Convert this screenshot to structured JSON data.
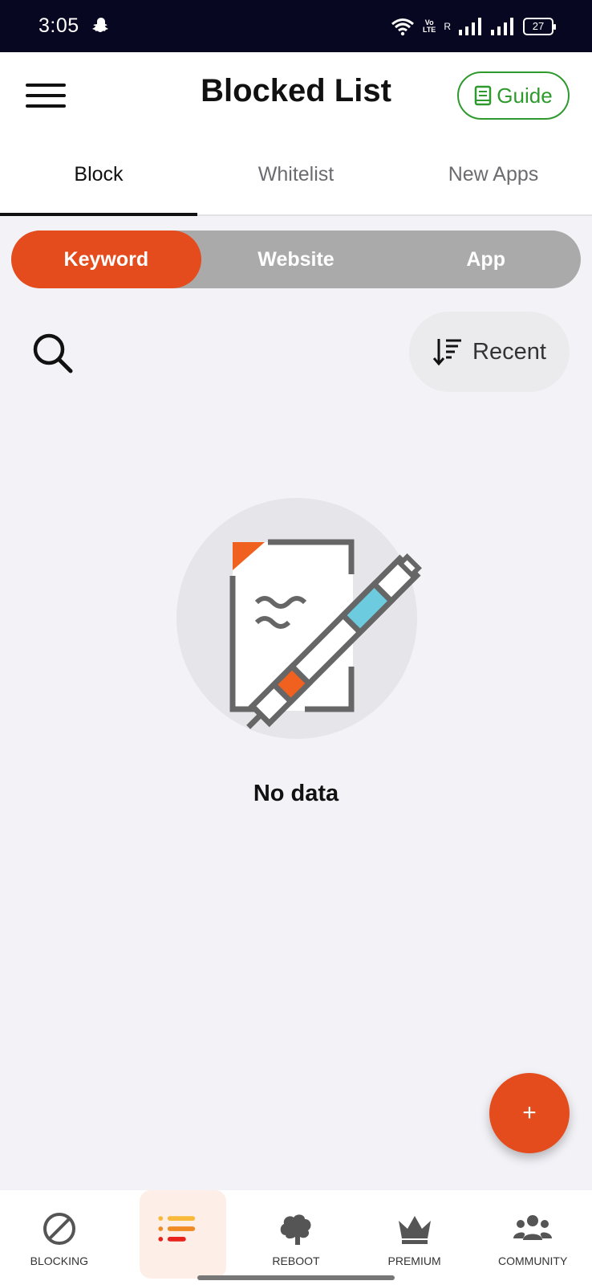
{
  "status": {
    "time": "3:05",
    "volte_top": "Vo",
    "volte_bottom": "LTE",
    "signal_label": "R",
    "battery": "27"
  },
  "header": {
    "title": "Blocked List",
    "guide_label": "Guide"
  },
  "tabs": [
    {
      "label": "Block",
      "active": true
    },
    {
      "label": "Whitelist",
      "active": false
    },
    {
      "label": "New Apps",
      "active": false
    }
  ],
  "segments": [
    {
      "label": "Keyword",
      "active": true
    },
    {
      "label": "Website",
      "active": false
    },
    {
      "label": "App",
      "active": false
    }
  ],
  "sort": {
    "label": "Recent"
  },
  "empty": {
    "label": "No data"
  },
  "fab": {
    "label": "+"
  },
  "nav": [
    {
      "label": "BLOCKING",
      "icon": "block-icon"
    },
    {
      "label": "",
      "icon": "list-icon",
      "active": true
    },
    {
      "label": "REBOOT",
      "icon": "brain-icon"
    },
    {
      "label": "PREMIUM",
      "icon": "crown-icon"
    },
    {
      "label": "COMMUNITY",
      "icon": "users-icon"
    }
  ],
  "colors": {
    "accent": "#e44c1d",
    "guide": "#2e9a2e",
    "segment_bg": "#aaaaaa",
    "status_bar": "#070722"
  }
}
